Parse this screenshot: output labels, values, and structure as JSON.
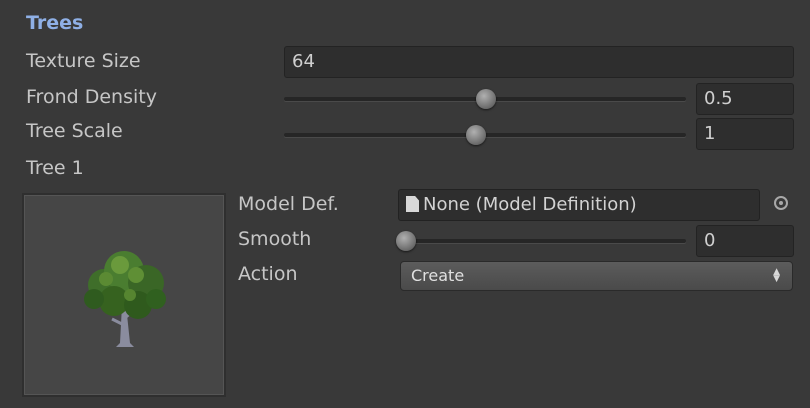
{
  "section": {
    "title": "Trees"
  },
  "texture_size": {
    "label": "Texture Size",
    "value": "64"
  },
  "frond_density": {
    "label": "Frond Density",
    "value": "0.5",
    "slider_fraction": 0.5
  },
  "tree_scale": {
    "label": "Tree Scale",
    "value": "1",
    "slider_fraction": 0.47
  },
  "tree1": {
    "label": "Tree 1",
    "preview_icon": "tree-icon",
    "model_def": {
      "label": "Model Def.",
      "value": "None (Model Definition)",
      "icon": "document-icon",
      "picker_icon": "object-picker-icon"
    },
    "smooth": {
      "label": "Smooth",
      "value": "0",
      "slider_fraction": 0.0
    },
    "action": {
      "label": "Action",
      "selected": "Create"
    }
  },
  "colors": {
    "background": "#393939",
    "section_title": "#8fb0e6",
    "field_background": "#2e2e2e"
  }
}
